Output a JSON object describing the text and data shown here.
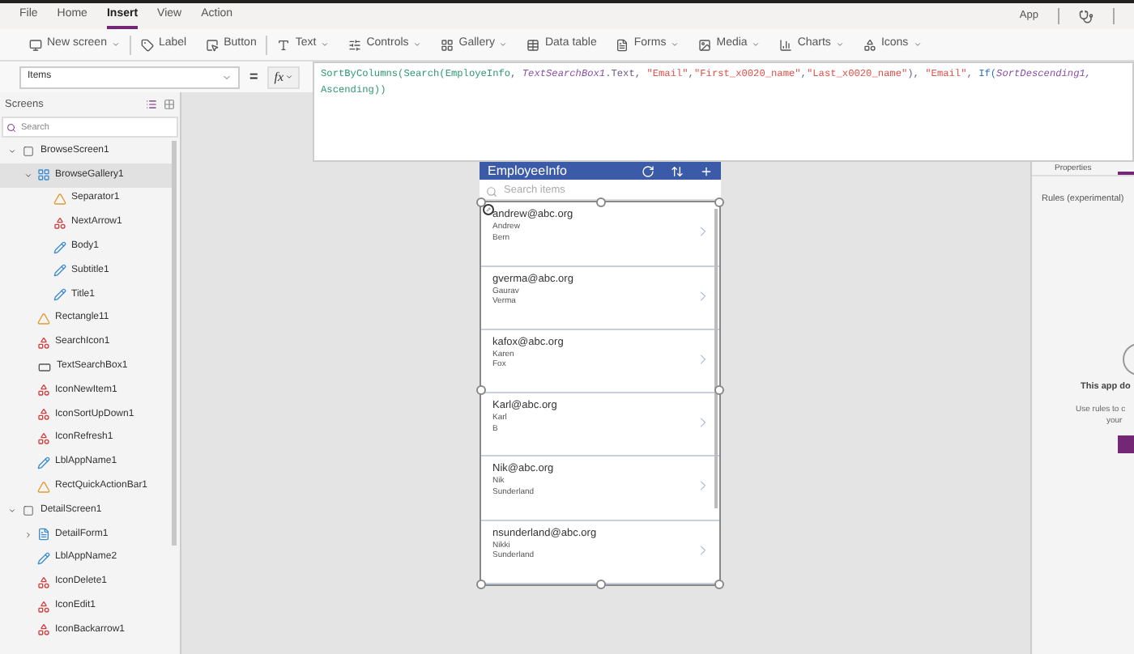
{
  "menu": [
    {
      "label": "File",
      "selected": false
    },
    {
      "label": "Home",
      "selected": false
    },
    {
      "label": "Insert",
      "selected": true
    },
    {
      "label": "View",
      "selected": false
    },
    {
      "label": "Action",
      "selected": false
    }
  ],
  "top_right": {
    "app": "App"
  },
  "toolbar": [
    {
      "label": "New screen",
      "kind": "screen",
      "dropdown": true
    },
    {
      "label": "Label",
      "kind": "label",
      "dropdown": false
    },
    {
      "label": "Button",
      "kind": "button",
      "dropdown": false
    },
    {
      "label": "Text",
      "kind": "text",
      "dropdown": true
    },
    {
      "label": "Controls",
      "kind": "controls",
      "dropdown": true
    },
    {
      "label": "Gallery",
      "kind": "gallery",
      "dropdown": true
    },
    {
      "label": "Data table",
      "kind": "table",
      "dropdown": false
    },
    {
      "label": "Forms",
      "kind": "forms",
      "dropdown": true
    },
    {
      "label": "Media",
      "kind": "media",
      "dropdown": true
    },
    {
      "label": "Charts",
      "kind": "charts",
      "dropdown": true
    },
    {
      "label": "Icons",
      "kind": "icons",
      "dropdown": true
    }
  ],
  "property": {
    "value": "Items",
    "equals": "=",
    "fx": "fx"
  },
  "formula": [
    [
      {
        "text": "SortByColumns(",
        "kind": "function"
      },
      {
        "text": "Search(",
        "kind": "function"
      },
      {
        "text": "EmployeInfo",
        "kind": "function"
      },
      {
        "text": ", ",
        "kind": "plain"
      },
      {
        "text": "TextSearchBox1",
        "kind": "control"
      },
      {
        "text": ".Text, ",
        "kind": "plain"
      },
      {
        "text": "\"Email\"",
        "kind": "string"
      },
      {
        "text": ",",
        "kind": "plain"
      },
      {
        "text": "\"First_x0020_name\"",
        "kind": "string"
      },
      {
        "text": ",",
        "kind": "plain"
      },
      {
        "text": "\"Last_x0020_name\"",
        "kind": "string"
      },
      {
        "text": "), ",
        "kind": "plain"
      },
      {
        "text": "\"Email\"",
        "kind": "string"
      },
      {
        "text": ", ",
        "kind": "plain"
      },
      {
        "text": "If(",
        "kind": "keyword"
      },
      {
        "text": "SortDescending1,",
        "kind": "control"
      }
    ],
    [
      {
        "text": "Ascending))",
        "kind": "function"
      }
    ]
  ],
  "sidebar": {
    "title": "Screens",
    "search": {
      "placeholder": "Search"
    },
    "tree": [
      {
        "label": "BrowseScreen1",
        "kind": "screen",
        "expanded": true,
        "selected": false,
        "children": [
          {
            "label": "BrowseGallery1",
            "kind": "gallery",
            "expanded": true,
            "selected": true,
            "children": [
              {
                "label": "Separator1",
                "kind": "shape",
                "selected": false
              },
              {
                "label": "NextArrow1",
                "kind": "icon",
                "selected": false
              },
              {
                "label": "Body1",
                "kind": "label",
                "selected": false
              },
              {
                "label": "Subtitle1",
                "kind": "label",
                "selected": false
              },
              {
                "label": "Title1",
                "kind": "label",
                "selected": false
              }
            ]
          },
          {
            "label": "Rectangle11",
            "kind": "shape",
            "selected": false
          },
          {
            "label": "SearchIcon1",
            "kind": "icon",
            "selected": false
          },
          {
            "label": "TextSearchBox1",
            "kind": "input",
            "selected": false
          },
          {
            "label": "IconNewItem1",
            "kind": "icon",
            "selected": false
          },
          {
            "label": "IconSortUpDown1",
            "kind": "icon",
            "selected": false
          },
          {
            "label": "IconRefresh1",
            "kind": "icon",
            "selected": false
          },
          {
            "label": "LblAppName1",
            "kind": "label",
            "selected": false
          },
          {
            "label": "RectQuickActionBar1",
            "kind": "shape",
            "selected": false
          }
        ]
      },
      {
        "label": "DetailScreen1",
        "kind": "screen",
        "expanded": true,
        "selected": false,
        "children": [
          {
            "label": "DetailForm1",
            "kind": "form",
            "expanded": false,
            "selected": false
          },
          {
            "label": "LblAppName2",
            "kind": "label",
            "selected": false
          },
          {
            "label": "IconDelete1",
            "kind": "icon",
            "selected": false
          },
          {
            "label": "IconEdit1",
            "kind": "icon",
            "selected": false
          },
          {
            "label": "IconBackarrow1",
            "kind": "icon",
            "selected": false
          }
        ]
      }
    ]
  },
  "app_preview": {
    "title": "EmployeeInfo",
    "search": {
      "placeholder": "Search items"
    },
    "rows": [
      {
        "email": "andrew@abc.org",
        "first": "Andrew",
        "last": "Bern"
      },
      {
        "email": "gverma@abc.org",
        "first": "Gaurav",
        "last": "Verma"
      },
      {
        "email": "kafox@abc.org",
        "first": "Karen",
        "last": "Fox"
      },
      {
        "email": "Karl@abc.org",
        "first": "Karl",
        "last": "B"
      },
      {
        "email": "Nik@abc.org",
        "first": "Nik",
        "last": "Sunderland"
      },
      {
        "email": "nsunderland@abc.org",
        "first": "Nikki",
        "last": "Sunderland"
      }
    ]
  },
  "right_panel": {
    "tab": "Properties",
    "heading": "Rules (experimental)",
    "message": "This app do",
    "hint_line_1": "Use rules to c",
    "hint_line_2": "your"
  }
}
